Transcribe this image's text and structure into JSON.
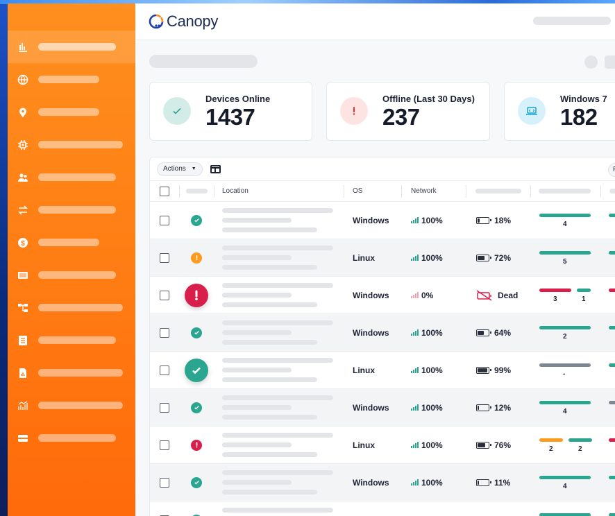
{
  "app": {
    "name": "Canopy"
  },
  "sidebar": {
    "items": [
      {
        "icon": "bar-chart-icon",
        "bar": 112,
        "active": true
      },
      {
        "icon": "globe-icon",
        "bar": 88
      },
      {
        "icon": "location-pin-icon",
        "bar": 88
      },
      {
        "icon": "chip-icon",
        "bar": 122
      },
      {
        "icon": "users-icon",
        "bar": 112
      },
      {
        "icon": "transfer-icon",
        "bar": 112
      },
      {
        "icon": "dollar-icon",
        "bar": 88
      },
      {
        "icon": "barcode-icon",
        "bar": 112
      },
      {
        "icon": "org-tree-icon",
        "bar": 122
      },
      {
        "icon": "document-icon",
        "bar": 112
      },
      {
        "icon": "report-icon",
        "bar": 122
      },
      {
        "icon": "analytics-icon",
        "bar": 122
      },
      {
        "icon": "card-icon",
        "bar": 112
      }
    ]
  },
  "cards": [
    {
      "label": "Devices Online",
      "value": "1437",
      "icon": "check-icon",
      "bg": "#d3ece7",
      "color": "#2aa58f"
    },
    {
      "label": "Offline (Last 30 Days)",
      "value": "237",
      "icon": "exclamation-icon",
      "bg": "#fde3e1",
      "color": "#e0322f"
    },
    {
      "label": "Windows 7",
      "value": "182",
      "icon": "laptop-icon",
      "bg": "#d6f1fb",
      "color": "#1aa3d1"
    }
  ],
  "toolbar": {
    "actions_label": "Actions",
    "right_label": "R"
  },
  "columns": {
    "location": "Location",
    "os": "OS",
    "network": "Network"
  },
  "colors": {
    "teal": "#2aa58f",
    "red": "#d81f4b",
    "orange": "#ff9a1a",
    "gray": "#7d8794"
  },
  "rows": [
    {
      "status": "ok",
      "big": false,
      "os": "Windows",
      "network": "100%",
      "net_color": "#2aa58f",
      "battery": "18%",
      "level": 0.18,
      "segments": [
        {
          "w": 74,
          "c": "teal",
          "label": "4"
        }
      ],
      "last": "teal"
    },
    {
      "status": "warn",
      "big": false,
      "os": "Linux",
      "network": "100%",
      "net_color": "#2aa58f",
      "battery": "72%",
      "level": 0.72,
      "segments": [
        {
          "w": 74,
          "c": "teal",
          "label": "5"
        }
      ],
      "last": "teal"
    },
    {
      "status": "error",
      "big": true,
      "os": "Windows",
      "network": "0%",
      "net_color": "#f1a5b3",
      "battery": "Dead",
      "level": -1,
      "segments": [
        {
          "w": 46,
          "c": "red",
          "label": "3"
        },
        {
          "w": 20,
          "c": "teal",
          "label": "1"
        }
      ],
      "last": "red"
    },
    {
      "status": "ok",
      "big": false,
      "os": "Windows",
      "network": "100%",
      "net_color": "#2aa58f",
      "battery": "64%",
      "level": 0.64,
      "segments": [
        {
          "w": 74,
          "c": "teal",
          "label": "2"
        }
      ],
      "last": "teal"
    },
    {
      "status": "ok",
      "big": true,
      "os": "Linux",
      "network": "100%",
      "net_color": "#2aa58f",
      "battery": "99%",
      "level": 0.99,
      "segments": [
        {
          "w": 74,
          "c": "gray",
          "label": "-"
        }
      ],
      "last": "teal"
    },
    {
      "status": "ok",
      "big": false,
      "os": "Windows",
      "network": "100%",
      "net_color": "#2aa58f",
      "battery": "12%",
      "level": 0.12,
      "segments": [
        {
          "w": 74,
          "c": "teal",
          "label": "4"
        }
      ],
      "last": "gray"
    },
    {
      "status": "error",
      "big": false,
      "os": "Linux",
      "network": "100%",
      "net_color": "#2aa58f",
      "battery": "76%",
      "level": 0.76,
      "segments": [
        {
          "w": 34,
          "c": "orange",
          "label": "2"
        },
        {
          "w": 34,
          "c": "teal",
          "label": "2"
        }
      ],
      "last": "red"
    },
    {
      "status": "ok",
      "big": false,
      "os": "Windows",
      "network": "100%",
      "net_color": "#2aa58f",
      "battery": "11%",
      "level": 0.11,
      "segments": [
        {
          "w": 74,
          "c": "teal",
          "label": "4"
        }
      ],
      "last": "teal"
    },
    {
      "status": "ok",
      "big": false,
      "os": "",
      "network": "",
      "net_color": "#2aa58f",
      "battery": "",
      "level": null,
      "segments": [
        {
          "w": 74,
          "c": "teal",
          "label": ""
        }
      ],
      "last": "teal"
    }
  ]
}
